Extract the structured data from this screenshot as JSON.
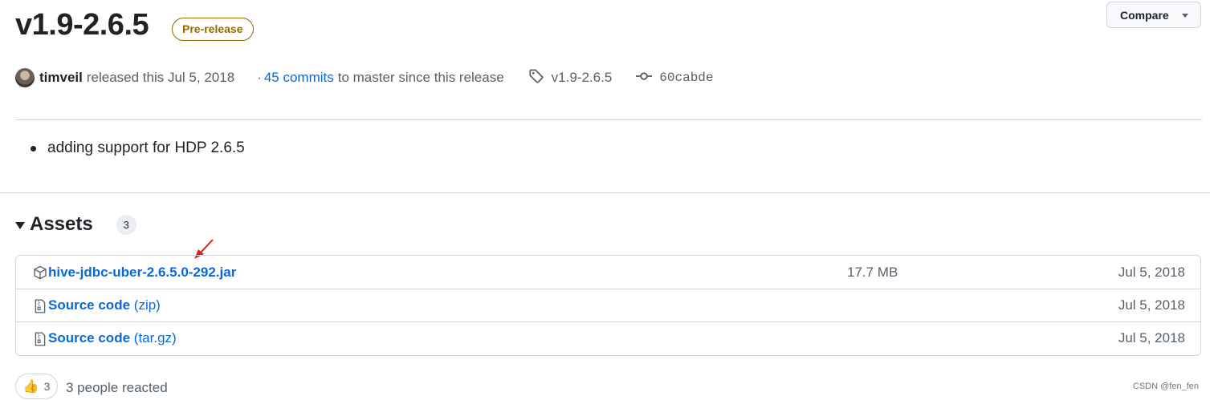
{
  "release": {
    "title": "v1.9-2.6.5",
    "badge": "Pre-release",
    "compare_label": "Compare"
  },
  "meta": {
    "author": "timveil",
    "released_text": "released this Jul 5, 2018",
    "bullet_sep": "·",
    "commits_link": "45 commits",
    "commits_suffix": "to master since this release",
    "tag": "v1.9-2.6.5",
    "commit": "60cabde"
  },
  "notes": {
    "items": [
      "adding support for HDP 2.6.5"
    ]
  },
  "assets": {
    "heading": "Assets",
    "count": "3",
    "rows": [
      {
        "icon": "package-icon",
        "name": "hive-jdbc-uber-2.6.5.0-292.jar",
        "suffix": "",
        "size": "17.7 MB",
        "date": "Jul 5, 2018"
      },
      {
        "icon": "file-zip-icon",
        "name": "Source code",
        "suffix": "(zip)",
        "size": "",
        "date": "Jul 5, 2018"
      },
      {
        "icon": "file-zip-icon",
        "name": "Source code",
        "suffix": "(tar.gz)",
        "size": "",
        "date": "Jul 5, 2018"
      }
    ]
  },
  "reactions": {
    "emoji": "👍",
    "count": "3",
    "text": "3 people reacted"
  },
  "watermark": "CSDN @fen_fen",
  "colors": {
    "link": "#0969da",
    "prerelease": "#9a6700",
    "annotation_arrow": "#e0201a"
  }
}
